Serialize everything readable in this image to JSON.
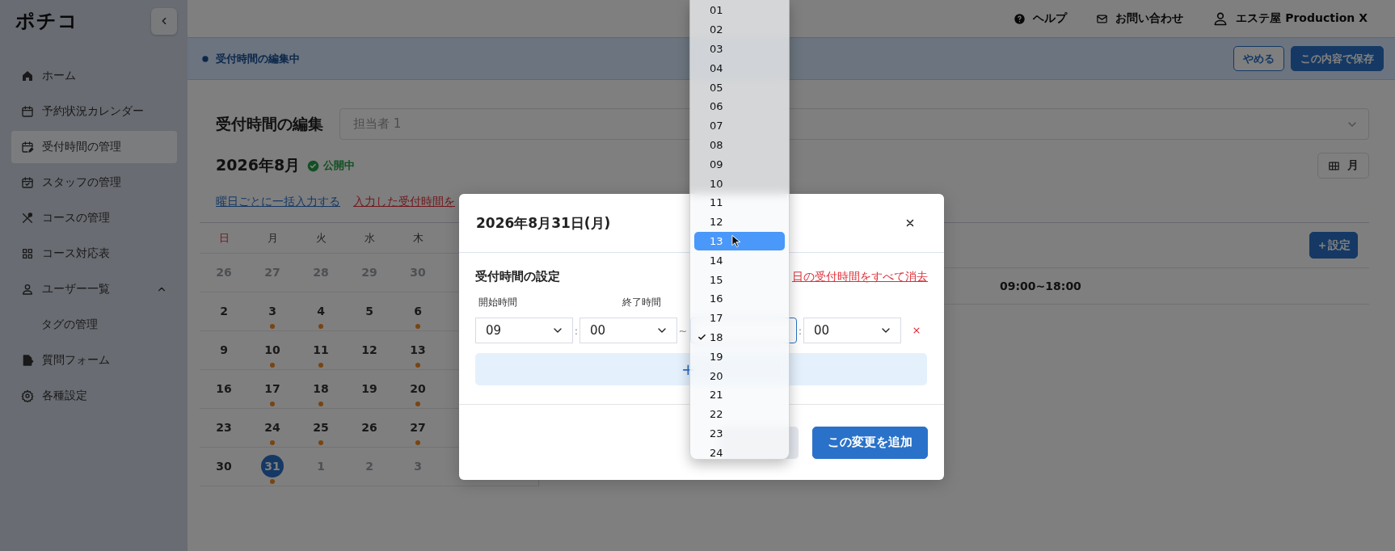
{
  "sidebar": {
    "logo": "ポチコ",
    "items": [
      {
        "label": "ホーム",
        "kind": "home",
        "selected": false
      },
      {
        "label": "予約状況カレンダー",
        "kind": "calendar",
        "selected": false
      },
      {
        "label": "受付時間の管理",
        "kind": "calendar-edit",
        "selected": true
      },
      {
        "label": "スタッフの管理",
        "kind": "calendar-check",
        "selected": false
      },
      {
        "label": "コースの管理",
        "kind": "utensils",
        "selected": false
      },
      {
        "label": "コース対応表",
        "kind": "grid",
        "selected": false
      },
      {
        "label": "ユーザー一覧",
        "kind": "user",
        "selected": false,
        "expanded": true,
        "children": [
          {
            "label": "タグの管理",
            "selected": false
          }
        ]
      },
      {
        "label": "質問フォーム",
        "kind": "form",
        "selected": false
      },
      {
        "label": "各種設定",
        "kind": "gear",
        "selected": false
      }
    ]
  },
  "header": {
    "links": [
      {
        "label": "ヘルプ",
        "kind": "help"
      },
      {
        "label": "お問い合わせ",
        "kind": "mail"
      },
      {
        "label": "エステ屋 Production X",
        "kind": "user"
      }
    ]
  },
  "edit_bar": {
    "status": "受付時間の編集中",
    "buttons": [
      {
        "label": "やめる",
        "kind": "secondary"
      },
      {
        "label": "この内容で保存",
        "kind": "primary"
      }
    ]
  },
  "page": {
    "title": "受付時間の編集",
    "staff_select": {
      "value": "担当者 1"
    },
    "month": "2026年8月",
    "status": {
      "label": "公開中"
    },
    "view_button": "月",
    "links": [
      {
        "label": "曜日ごとに一括入力する",
        "kind": "primary"
      },
      {
        "label": "入力した受付時間を",
        "kind": "danger"
      }
    ]
  },
  "calendar": {
    "weekdays": [
      {
        "label": "日",
        "holiday": true
      },
      {
        "label": "月",
        "holiday": false
      },
      {
        "label": "火",
        "holiday": false
      },
      {
        "label": "水",
        "holiday": false
      },
      {
        "label": "木",
        "holiday": false
      }
    ],
    "weeks": [
      [
        {
          "day": "26",
          "outside": true,
          "booked": false,
          "selected": false
        },
        {
          "day": "27",
          "outside": true,
          "booked": false,
          "selected": false
        },
        {
          "day": "28",
          "outside": true,
          "booked": false,
          "selected": false
        },
        {
          "day": "29",
          "outside": true,
          "booked": false,
          "selected": false
        },
        {
          "day": "30",
          "outside": true,
          "booked": false,
          "selected": false
        }
      ],
      [
        {
          "day": "2",
          "outside": false,
          "booked": false,
          "selected": false
        },
        {
          "day": "3",
          "outside": false,
          "booked": true,
          "selected": false
        },
        {
          "day": "4",
          "outside": false,
          "booked": true,
          "selected": false
        },
        {
          "day": "5",
          "outside": false,
          "booked": false,
          "selected": false
        },
        {
          "day": "6",
          "outside": false,
          "booked": true,
          "selected": false
        }
      ],
      [
        {
          "day": "9",
          "outside": false,
          "booked": false,
          "selected": false
        },
        {
          "day": "10",
          "outside": false,
          "booked": true,
          "selected": false
        },
        {
          "day": "11",
          "outside": false,
          "booked": true,
          "selected": false
        },
        {
          "day": "12",
          "outside": false,
          "booked": false,
          "selected": false
        },
        {
          "day": "13",
          "outside": false,
          "booked": true,
          "selected": false
        }
      ],
      [
        {
          "day": "16",
          "outside": false,
          "booked": false,
          "selected": false
        },
        {
          "day": "17",
          "outside": false,
          "booked": true,
          "selected": false
        },
        {
          "day": "18",
          "outside": false,
          "booked": true,
          "selected": false
        },
        {
          "day": "19",
          "outside": false,
          "booked": false,
          "selected": false
        },
        {
          "day": "20",
          "outside": false,
          "booked": true,
          "selected": false
        }
      ],
      [
        {
          "day": "23",
          "outside": false,
          "booked": false,
          "selected": false
        },
        {
          "day": "24",
          "outside": false,
          "booked": true,
          "selected": false
        },
        {
          "day": "25",
          "outside": false,
          "booked": true,
          "selected": false
        },
        {
          "day": "26",
          "outside": false,
          "booked": false,
          "selected": false
        },
        {
          "day": "27",
          "outside": false,
          "booked": true,
          "selected": false
        }
      ],
      [
        {
          "day": "30",
          "outside": false,
          "booked": false,
          "selected": false
        },
        {
          "day": "31",
          "outside": false,
          "booked": true,
          "selected": true
        },
        {
          "day": "1",
          "outside": true,
          "booked": false,
          "selected": false
        },
        {
          "day": "2",
          "outside": true,
          "booked": false,
          "selected": false
        },
        {
          "day": "3",
          "outside": true,
          "booked": false,
          "selected": false
        }
      ]
    ]
  },
  "day_panel": {
    "add_button": "＋設定",
    "hours": "09:00~18:00"
  },
  "modal": {
    "title": "2026年8月31日(月)",
    "section_title": "受付時間の設定",
    "clear_link": "日の受付時間をすべて消去",
    "start_label": "開始時間",
    "end_label": "終了時間",
    "slots": [
      {
        "start_hour": "09",
        "start_minute": "00",
        "range_separator": "~",
        "end_minute": "00",
        "time_separator": ":"
      }
    ],
    "add_slot": "+",
    "buttons": [
      {
        "kind": "secondary"
      },
      {
        "kind": "primary",
        "label": "この変更を追加"
      }
    ]
  },
  "hour_dropdown": {
    "options": [
      {
        "label": "01",
        "selected": false,
        "highlighted": false
      },
      {
        "label": "02",
        "selected": false,
        "highlighted": false
      },
      {
        "label": "03",
        "selected": false,
        "highlighted": false
      },
      {
        "label": "04",
        "selected": false,
        "highlighted": false
      },
      {
        "label": "05",
        "selected": false,
        "highlighted": false
      },
      {
        "label": "06",
        "selected": false,
        "highlighted": false
      },
      {
        "label": "07",
        "selected": false,
        "highlighted": false
      },
      {
        "label": "08",
        "selected": false,
        "highlighted": false
      },
      {
        "label": "09",
        "selected": false,
        "highlighted": false
      },
      {
        "label": "10",
        "selected": false,
        "highlighted": false
      },
      {
        "label": "11",
        "selected": false,
        "highlighted": false
      },
      {
        "label": "12",
        "selected": false,
        "highlighted": false
      },
      {
        "label": "13",
        "selected": false,
        "highlighted": true
      },
      {
        "label": "14",
        "selected": false,
        "highlighted": false
      },
      {
        "label": "15",
        "selected": false,
        "highlighted": false
      },
      {
        "label": "16",
        "selected": false,
        "highlighted": false
      },
      {
        "label": "17",
        "selected": false,
        "highlighted": false
      },
      {
        "label": "18",
        "selected": true,
        "highlighted": false
      },
      {
        "label": "19",
        "selected": false,
        "highlighted": false
      },
      {
        "label": "20",
        "selected": false,
        "highlighted": false
      },
      {
        "label": "21",
        "selected": false,
        "highlighted": false
      },
      {
        "label": "22",
        "selected": false,
        "highlighted": false
      },
      {
        "label": "23",
        "selected": false,
        "highlighted": false
      },
      {
        "label": "24",
        "selected": false,
        "highlighted": false
      }
    ]
  }
}
